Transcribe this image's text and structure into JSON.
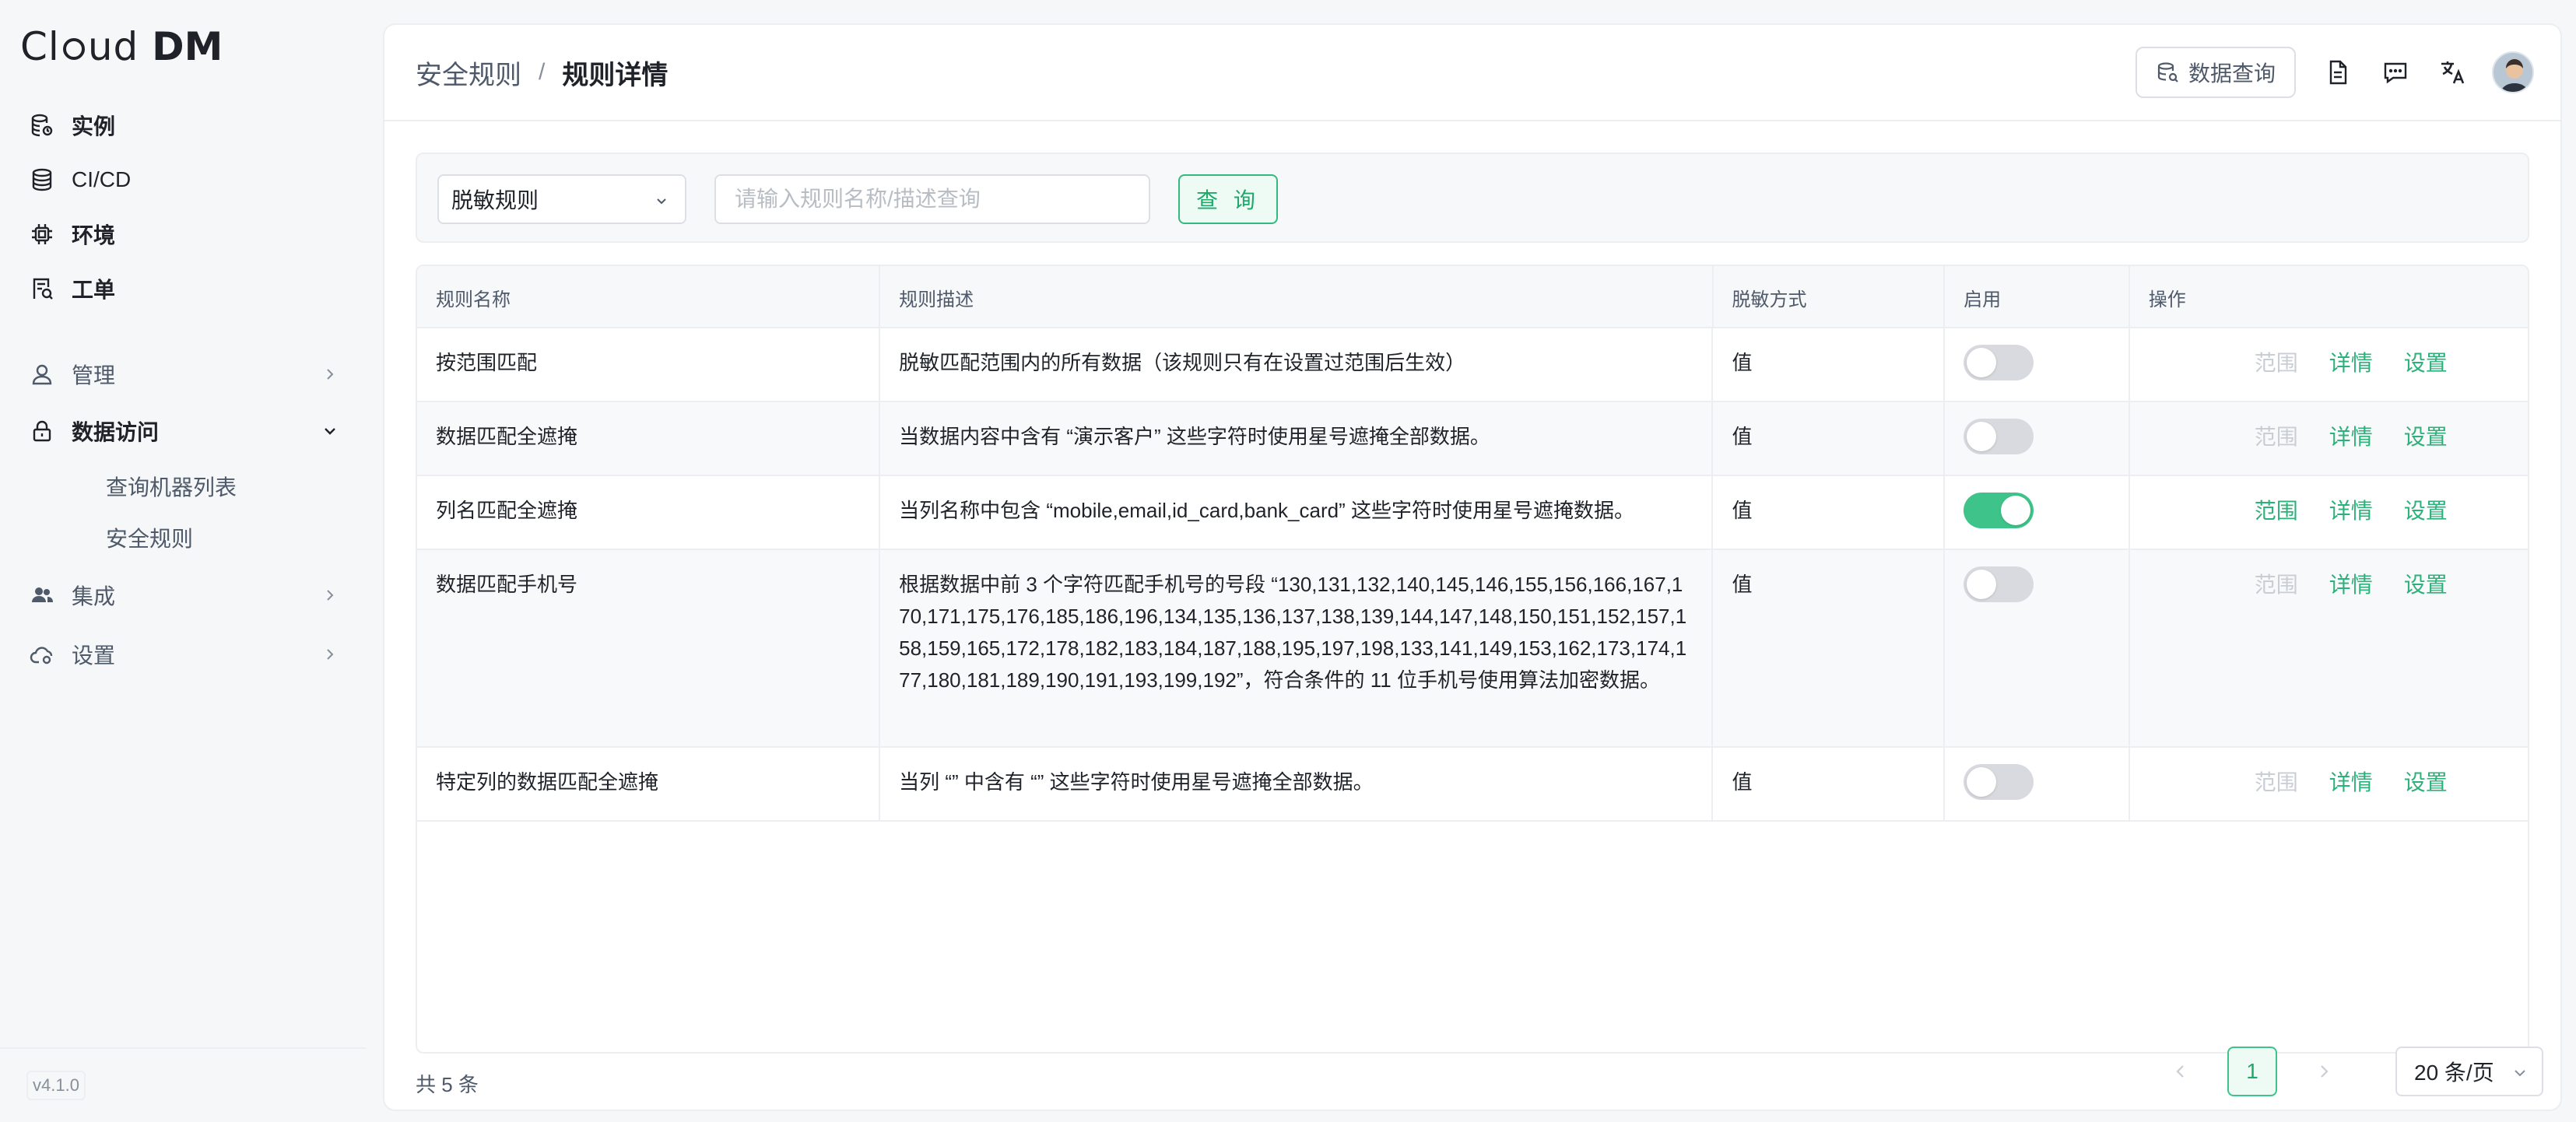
{
  "app": {
    "logo_light": "Cl",
    "logo_mid": "ud ",
    "logo_bold": "DM",
    "version": "v4.1.0"
  },
  "sidebar": {
    "items": [
      {
        "label": "实例",
        "icon": "database-stack-icon"
      },
      {
        "label": "CI/CD",
        "icon": "database-icon"
      },
      {
        "label": "环境",
        "icon": "chip-icon"
      },
      {
        "label": "工单",
        "icon": "ticket-icon"
      }
    ],
    "groups": [
      {
        "label": "管理",
        "icon": "user-icon",
        "expanded": false
      },
      {
        "label": "数据访问",
        "icon": "lock-icon",
        "expanded": true
      },
      {
        "label": "集成",
        "icon": "users-icon",
        "expanded": false
      },
      {
        "label": "设置",
        "icon": "cloud-settings-icon",
        "expanded": false
      }
    ],
    "subitems": [
      {
        "label": "查询机器列表"
      },
      {
        "label": "安全规则"
      }
    ]
  },
  "header": {
    "breadcrumb_parent": "安全规则",
    "breadcrumb_sep": "/",
    "breadcrumb_current": "规则详情",
    "data_query_label": "数据查询"
  },
  "filter": {
    "select_value": "脱敏规则",
    "search_placeholder": "请输入规则名称/描述查询",
    "query_label": "查 询"
  },
  "table": {
    "columns": [
      "规则名称",
      "规则描述",
      "脱敏方式",
      "启用",
      "操作"
    ],
    "rows": [
      {
        "name": "按范围匹配",
        "desc": "脱敏匹配范围内的所有数据（该规则只有在设置过范围后生效）",
        "method": "值",
        "enabled": false,
        "range": "范围",
        "detail": "详情",
        "settings": "设置"
      },
      {
        "name": "数据匹配全遮掩",
        "desc": "当数据内容中含有 “演示客户” 这些字符时使用星号遮掩全部数据。",
        "method": "值",
        "enabled": false,
        "range": "范围",
        "detail": "详情",
        "settings": "设置"
      },
      {
        "name": "列名匹配全遮掩",
        "desc": "当列名称中包含 “mobile,email,id_card,bank_card” 这些字符时使用星号遮掩数据。",
        "method": "值",
        "enabled": true,
        "range": "范围",
        "detail": "详情",
        "settings": "设置"
      },
      {
        "name": "数据匹配手机号",
        "desc": "根据数据中前 3 个字符匹配手机号的号段 “130,131,132,140,145,146,155,156,166,167,170,171,175,176,185,186,196,134,135,136,137,138,139,144,147,148,150,151,152,157,158,159,165,172,178,182,183,184,187,188,195,197,198,133,141,149,153,162,173,174,177,180,181,189,190,191,193,199,192”，符合条件的 11 位手机号使用算法加密数据。",
        "method": "值",
        "enabled": false,
        "range": "范围",
        "detail": "详情",
        "settings": "设置"
      },
      {
        "name": "特定列的数据匹配全遮掩",
        "desc": "当列 “” 中含有 “” 这些字符时使用星号遮掩全部数据。",
        "method": "值",
        "enabled": false,
        "range": "范围",
        "detail": "详情",
        "settings": "设置"
      }
    ]
  },
  "pagination": {
    "total_text": "共 5 条",
    "current_page": "1",
    "page_size": "20 条/页"
  },
  "colors": {
    "accent": "#3ec48a",
    "accent_text": "#20a86b",
    "disabled_text": "#c9cdd4"
  }
}
